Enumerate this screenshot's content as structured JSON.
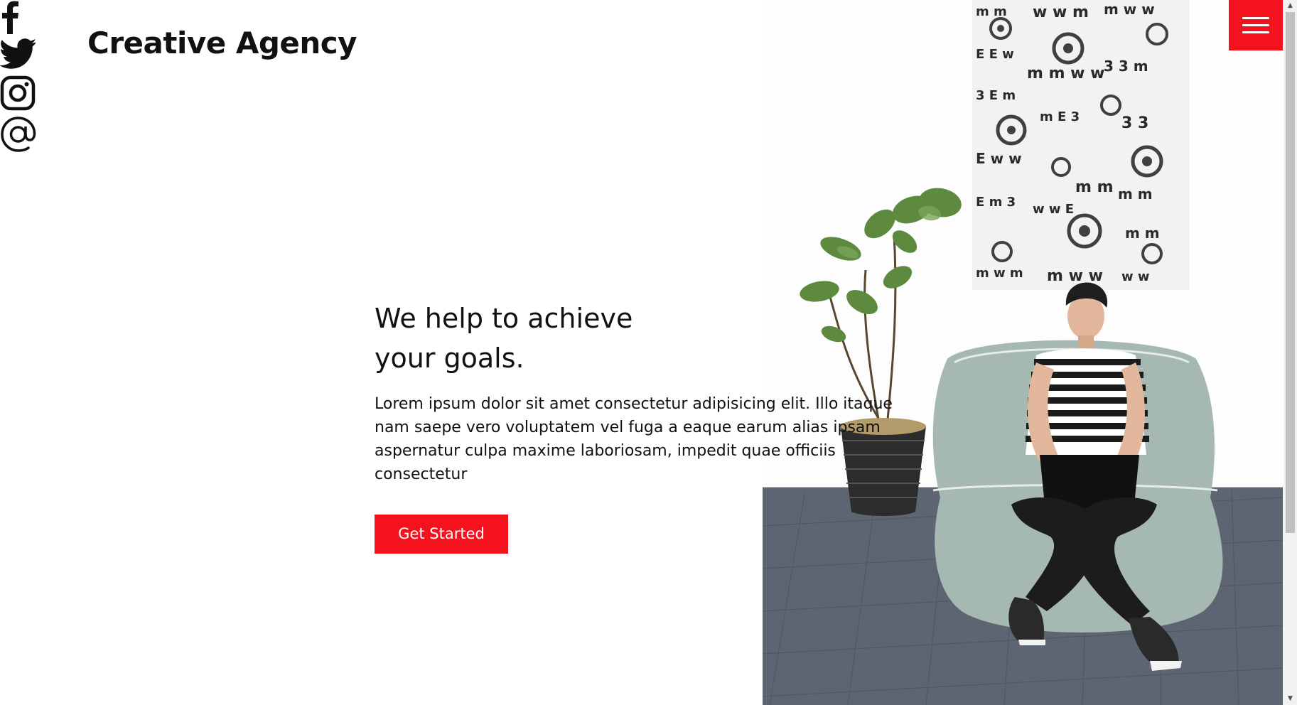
{
  "brand": {
    "logo_text": "Creative Agency",
    "accent_color": "#f5121f"
  },
  "social": [
    {
      "name": "facebook",
      "icon": "facebook-icon"
    },
    {
      "name": "twitter",
      "icon": "twitter-icon"
    },
    {
      "name": "instagram",
      "icon": "instagram-icon"
    },
    {
      "name": "email",
      "icon": "at-sign-icon"
    }
  ],
  "hero": {
    "title": "We help to achieve your goals.",
    "text": "Lorem ipsum dolor sit amet consectetur adipisicing elit. Illo itaque nam saepe vero voluptatem vel fuga a eaque earum alias ipsam aspernatur culpa maxime laboriosam, impedit quae officiis consectetur",
    "cta_label": "Get Started",
    "photo": "person-on-beanbag-with-laptop-photo"
  },
  "menu": {
    "icon": "hamburger-menu-icon"
  },
  "scrollbar": {
    "up_arrow": "▲",
    "down_arrow": "▼"
  }
}
